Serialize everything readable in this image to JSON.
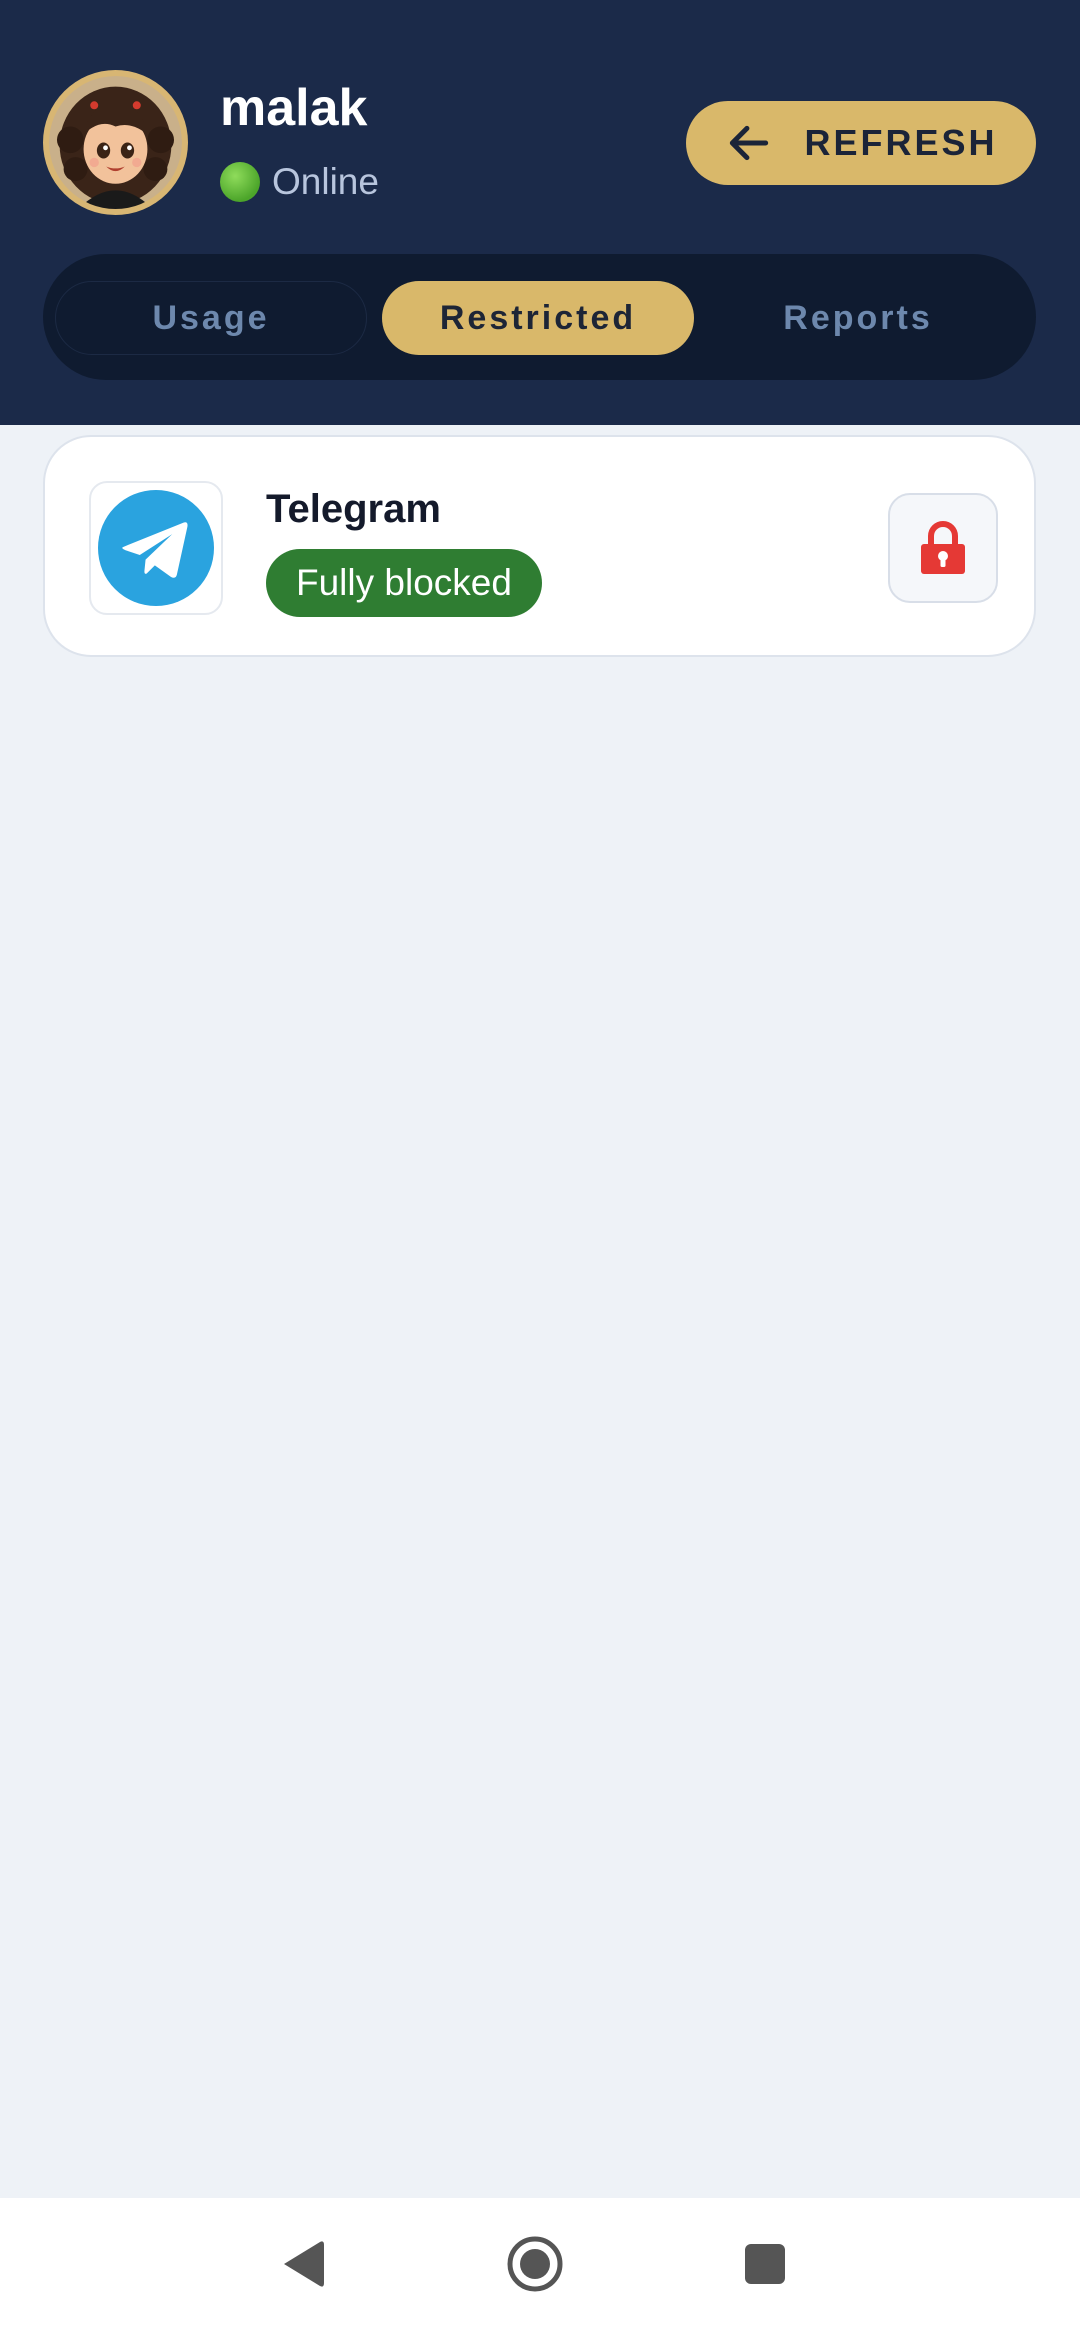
{
  "profile": {
    "name": "malak",
    "status": "Online"
  },
  "header": {
    "refresh_label": "REFRESH"
  },
  "tabs": [
    {
      "label": "Usage",
      "active": false
    },
    {
      "label": "Restricted",
      "active": true
    },
    {
      "label": "Reports",
      "active": false
    }
  ],
  "restricted_apps": [
    {
      "name": "Telegram",
      "status": "Fully blocked",
      "icon": "telegram-icon",
      "lock_icon": "lock-icon"
    }
  ],
  "colors": {
    "header_bg": "#1b2a49",
    "accent_gold": "#d9b86a",
    "blocked_badge": "#2f7d32",
    "lock_red": "#e53935",
    "online_green": "#4ca52a",
    "telegram_blue": "#2aa3df"
  },
  "system_nav": [
    "back-icon",
    "home-icon",
    "recent-apps-icon"
  ]
}
